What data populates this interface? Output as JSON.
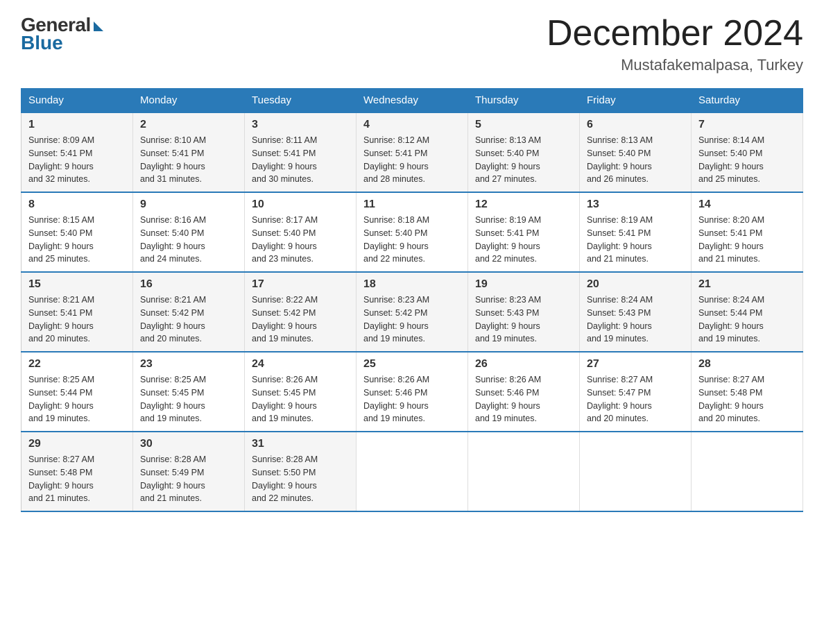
{
  "logo": {
    "general": "General",
    "blue": "Blue"
  },
  "header": {
    "month": "December 2024",
    "location": "Mustafakemalpasa, Turkey"
  },
  "days_of_week": [
    "Sunday",
    "Monday",
    "Tuesday",
    "Wednesday",
    "Thursday",
    "Friday",
    "Saturday"
  ],
  "weeks": [
    [
      {
        "day": "1",
        "sunrise": "8:09 AM",
        "sunset": "5:41 PM",
        "daylight": "9 hours and 32 minutes."
      },
      {
        "day": "2",
        "sunrise": "8:10 AM",
        "sunset": "5:41 PM",
        "daylight": "9 hours and 31 minutes."
      },
      {
        "day": "3",
        "sunrise": "8:11 AM",
        "sunset": "5:41 PM",
        "daylight": "9 hours and 30 minutes."
      },
      {
        "day": "4",
        "sunrise": "8:12 AM",
        "sunset": "5:41 PM",
        "daylight": "9 hours and 28 minutes."
      },
      {
        "day": "5",
        "sunrise": "8:13 AM",
        "sunset": "5:40 PM",
        "daylight": "9 hours and 27 minutes."
      },
      {
        "day": "6",
        "sunrise": "8:13 AM",
        "sunset": "5:40 PM",
        "daylight": "9 hours and 26 minutes."
      },
      {
        "day": "7",
        "sunrise": "8:14 AM",
        "sunset": "5:40 PM",
        "daylight": "9 hours and 25 minutes."
      }
    ],
    [
      {
        "day": "8",
        "sunrise": "8:15 AM",
        "sunset": "5:40 PM",
        "daylight": "9 hours and 25 minutes."
      },
      {
        "day": "9",
        "sunrise": "8:16 AM",
        "sunset": "5:40 PM",
        "daylight": "9 hours and 24 minutes."
      },
      {
        "day": "10",
        "sunrise": "8:17 AM",
        "sunset": "5:40 PM",
        "daylight": "9 hours and 23 minutes."
      },
      {
        "day": "11",
        "sunrise": "8:18 AM",
        "sunset": "5:40 PM",
        "daylight": "9 hours and 22 minutes."
      },
      {
        "day": "12",
        "sunrise": "8:19 AM",
        "sunset": "5:41 PM",
        "daylight": "9 hours and 22 minutes."
      },
      {
        "day": "13",
        "sunrise": "8:19 AM",
        "sunset": "5:41 PM",
        "daylight": "9 hours and 21 minutes."
      },
      {
        "day": "14",
        "sunrise": "8:20 AM",
        "sunset": "5:41 PM",
        "daylight": "9 hours and 21 minutes."
      }
    ],
    [
      {
        "day": "15",
        "sunrise": "8:21 AM",
        "sunset": "5:41 PM",
        "daylight": "9 hours and 20 minutes."
      },
      {
        "day": "16",
        "sunrise": "8:21 AM",
        "sunset": "5:42 PM",
        "daylight": "9 hours and 20 minutes."
      },
      {
        "day": "17",
        "sunrise": "8:22 AM",
        "sunset": "5:42 PM",
        "daylight": "9 hours and 19 minutes."
      },
      {
        "day": "18",
        "sunrise": "8:23 AM",
        "sunset": "5:42 PM",
        "daylight": "9 hours and 19 minutes."
      },
      {
        "day": "19",
        "sunrise": "8:23 AM",
        "sunset": "5:43 PM",
        "daylight": "9 hours and 19 minutes."
      },
      {
        "day": "20",
        "sunrise": "8:24 AM",
        "sunset": "5:43 PM",
        "daylight": "9 hours and 19 minutes."
      },
      {
        "day": "21",
        "sunrise": "8:24 AM",
        "sunset": "5:44 PM",
        "daylight": "9 hours and 19 minutes."
      }
    ],
    [
      {
        "day": "22",
        "sunrise": "8:25 AM",
        "sunset": "5:44 PM",
        "daylight": "9 hours and 19 minutes."
      },
      {
        "day": "23",
        "sunrise": "8:25 AM",
        "sunset": "5:45 PM",
        "daylight": "9 hours and 19 minutes."
      },
      {
        "day": "24",
        "sunrise": "8:26 AM",
        "sunset": "5:45 PM",
        "daylight": "9 hours and 19 minutes."
      },
      {
        "day": "25",
        "sunrise": "8:26 AM",
        "sunset": "5:46 PM",
        "daylight": "9 hours and 19 minutes."
      },
      {
        "day": "26",
        "sunrise": "8:26 AM",
        "sunset": "5:46 PM",
        "daylight": "9 hours and 19 minutes."
      },
      {
        "day": "27",
        "sunrise": "8:27 AM",
        "sunset": "5:47 PM",
        "daylight": "9 hours and 20 minutes."
      },
      {
        "day": "28",
        "sunrise": "8:27 AM",
        "sunset": "5:48 PM",
        "daylight": "9 hours and 20 minutes."
      }
    ],
    [
      {
        "day": "29",
        "sunrise": "8:27 AM",
        "sunset": "5:48 PM",
        "daylight": "9 hours and 21 minutes."
      },
      {
        "day": "30",
        "sunrise": "8:28 AM",
        "sunset": "5:49 PM",
        "daylight": "9 hours and 21 minutes."
      },
      {
        "day": "31",
        "sunrise": "8:28 AM",
        "sunset": "5:50 PM",
        "daylight": "9 hours and 22 minutes."
      },
      null,
      null,
      null,
      null
    ]
  ],
  "labels": {
    "sunrise": "Sunrise:",
    "sunset": "Sunset:",
    "daylight": "Daylight:"
  }
}
